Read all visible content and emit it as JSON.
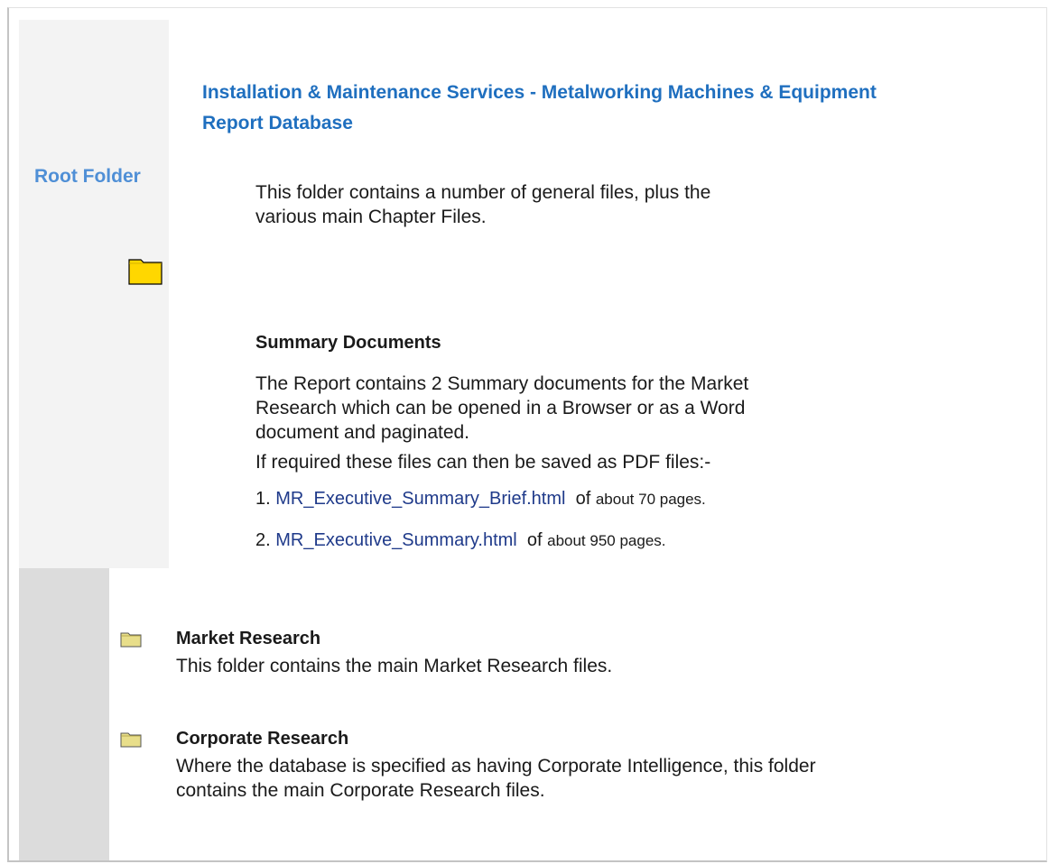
{
  "root": {
    "label": "Root Folder",
    "folder_icon": "folder-icon"
  },
  "report": {
    "title": "Installation & Maintenance Services - Metalworking Machines & Equipment Report Database"
  },
  "intro": {
    "text": "This folder contains a number of general files, plus the various main Chapter Files."
  },
  "summary": {
    "heading": "Summary Documents",
    "body": "The Report contains 2 Summary documents for the Market Research which can be opened in a Browser or as a Word document and paginated.",
    "pdf_note": "If required these files can then be saved as PDF files:-",
    "items": [
      {
        "number": "1.",
        "link": "MR_Executive_Summary_Brief.html",
        "of": "of",
        "pages": "about 70 pages."
      },
      {
        "number": "2.",
        "link": "MR_Executive_Summary.html",
        "of": "of",
        "pages": "about 950 pages."
      }
    ]
  },
  "folders": [
    {
      "icon": "folder-icon",
      "title": "Market Research",
      "description": "This folder contains the main Market Research files."
    },
    {
      "icon": "folder-icon",
      "title": "Corporate Research",
      "description": "Where the database is specified as having Corporate Intelligence, this folder contains the main Corporate Research files."
    }
  ],
  "colors": {
    "title_blue": "#1f6fbf",
    "root_label_blue": "#4f8fd6",
    "link_blue": "#1f3a8a",
    "folder_yellow": "#ffd700",
    "panel_light": "#f3f3f3",
    "panel_gray": "#dcdcdc"
  }
}
